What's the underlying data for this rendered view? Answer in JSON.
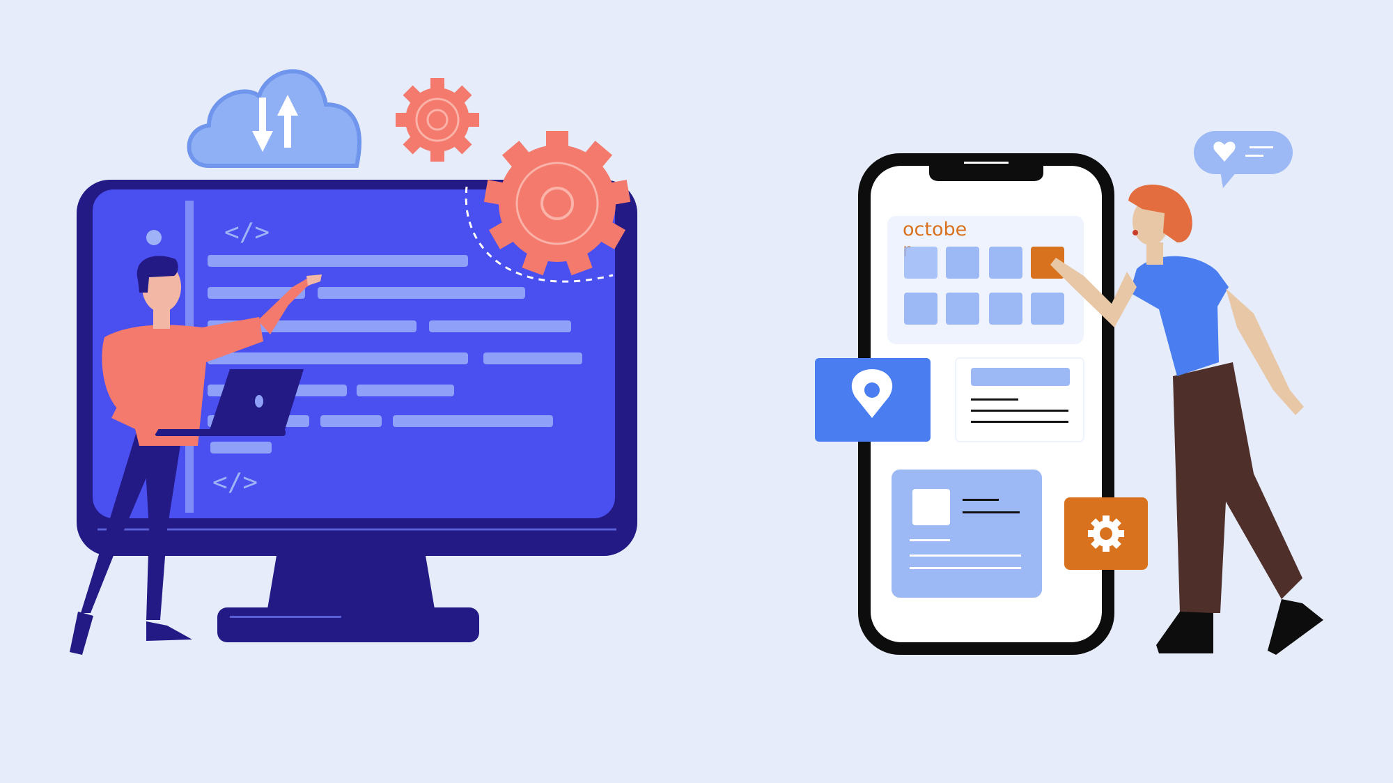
{
  "monitor": {
    "code_open_tag": "</>",
    "code_close_tag": "</>"
  },
  "phone": {
    "calendar": {
      "month_line1": "octobe",
      "month_line2": "r",
      "highlighted_day_index": 3
    }
  },
  "colors": {
    "background": "#e6ecfa",
    "monitor_frame": "#241a86",
    "monitor_screen": "#4a4ff0",
    "code_line": "#8ea0f7",
    "gear": "#f37a6c",
    "cloud": "#8fb0f5",
    "phone_frame": "#0d0d0d",
    "calendar_cell": "#9cb9f6",
    "calendar_accent": "#d9721f",
    "location_card": "#4a7ef0",
    "settings_card": "#d9721f"
  },
  "icons": {
    "cloud": "cloud-sync-icon",
    "gear_small": "gear-icon",
    "gear_large": "gear-icon",
    "location": "location-pin-icon",
    "settings": "gear-icon",
    "chat": "heart-chat-bubble-icon"
  }
}
